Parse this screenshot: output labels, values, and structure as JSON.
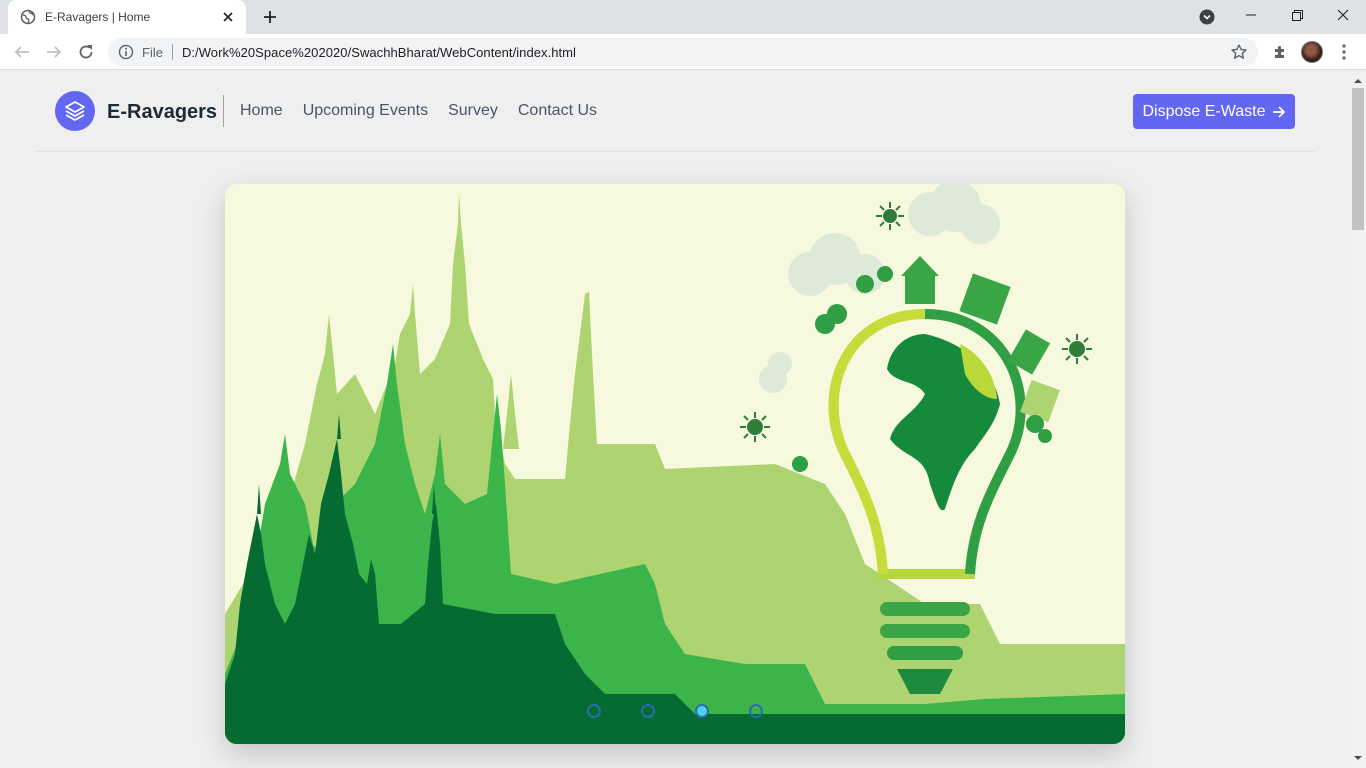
{
  "browser": {
    "tab_title": "E-Ravagers | Home",
    "address_scheme_label": "File",
    "address_url": "D:/Work%20Space%202020/SwachhBharat/WebContent/index.html"
  },
  "site": {
    "brand": "E-Ravagers",
    "nav": [
      "Home",
      "Upcoming Events",
      "Survey",
      "Contact Us"
    ],
    "cta_label": "Dispose E-Waste",
    "accent_color": "#6366f1"
  },
  "carousel": {
    "slide_count": 4,
    "active_index": 2,
    "image_description_icons": [
      "city-silhouette",
      "eco-lightbulb-globe"
    ]
  }
}
